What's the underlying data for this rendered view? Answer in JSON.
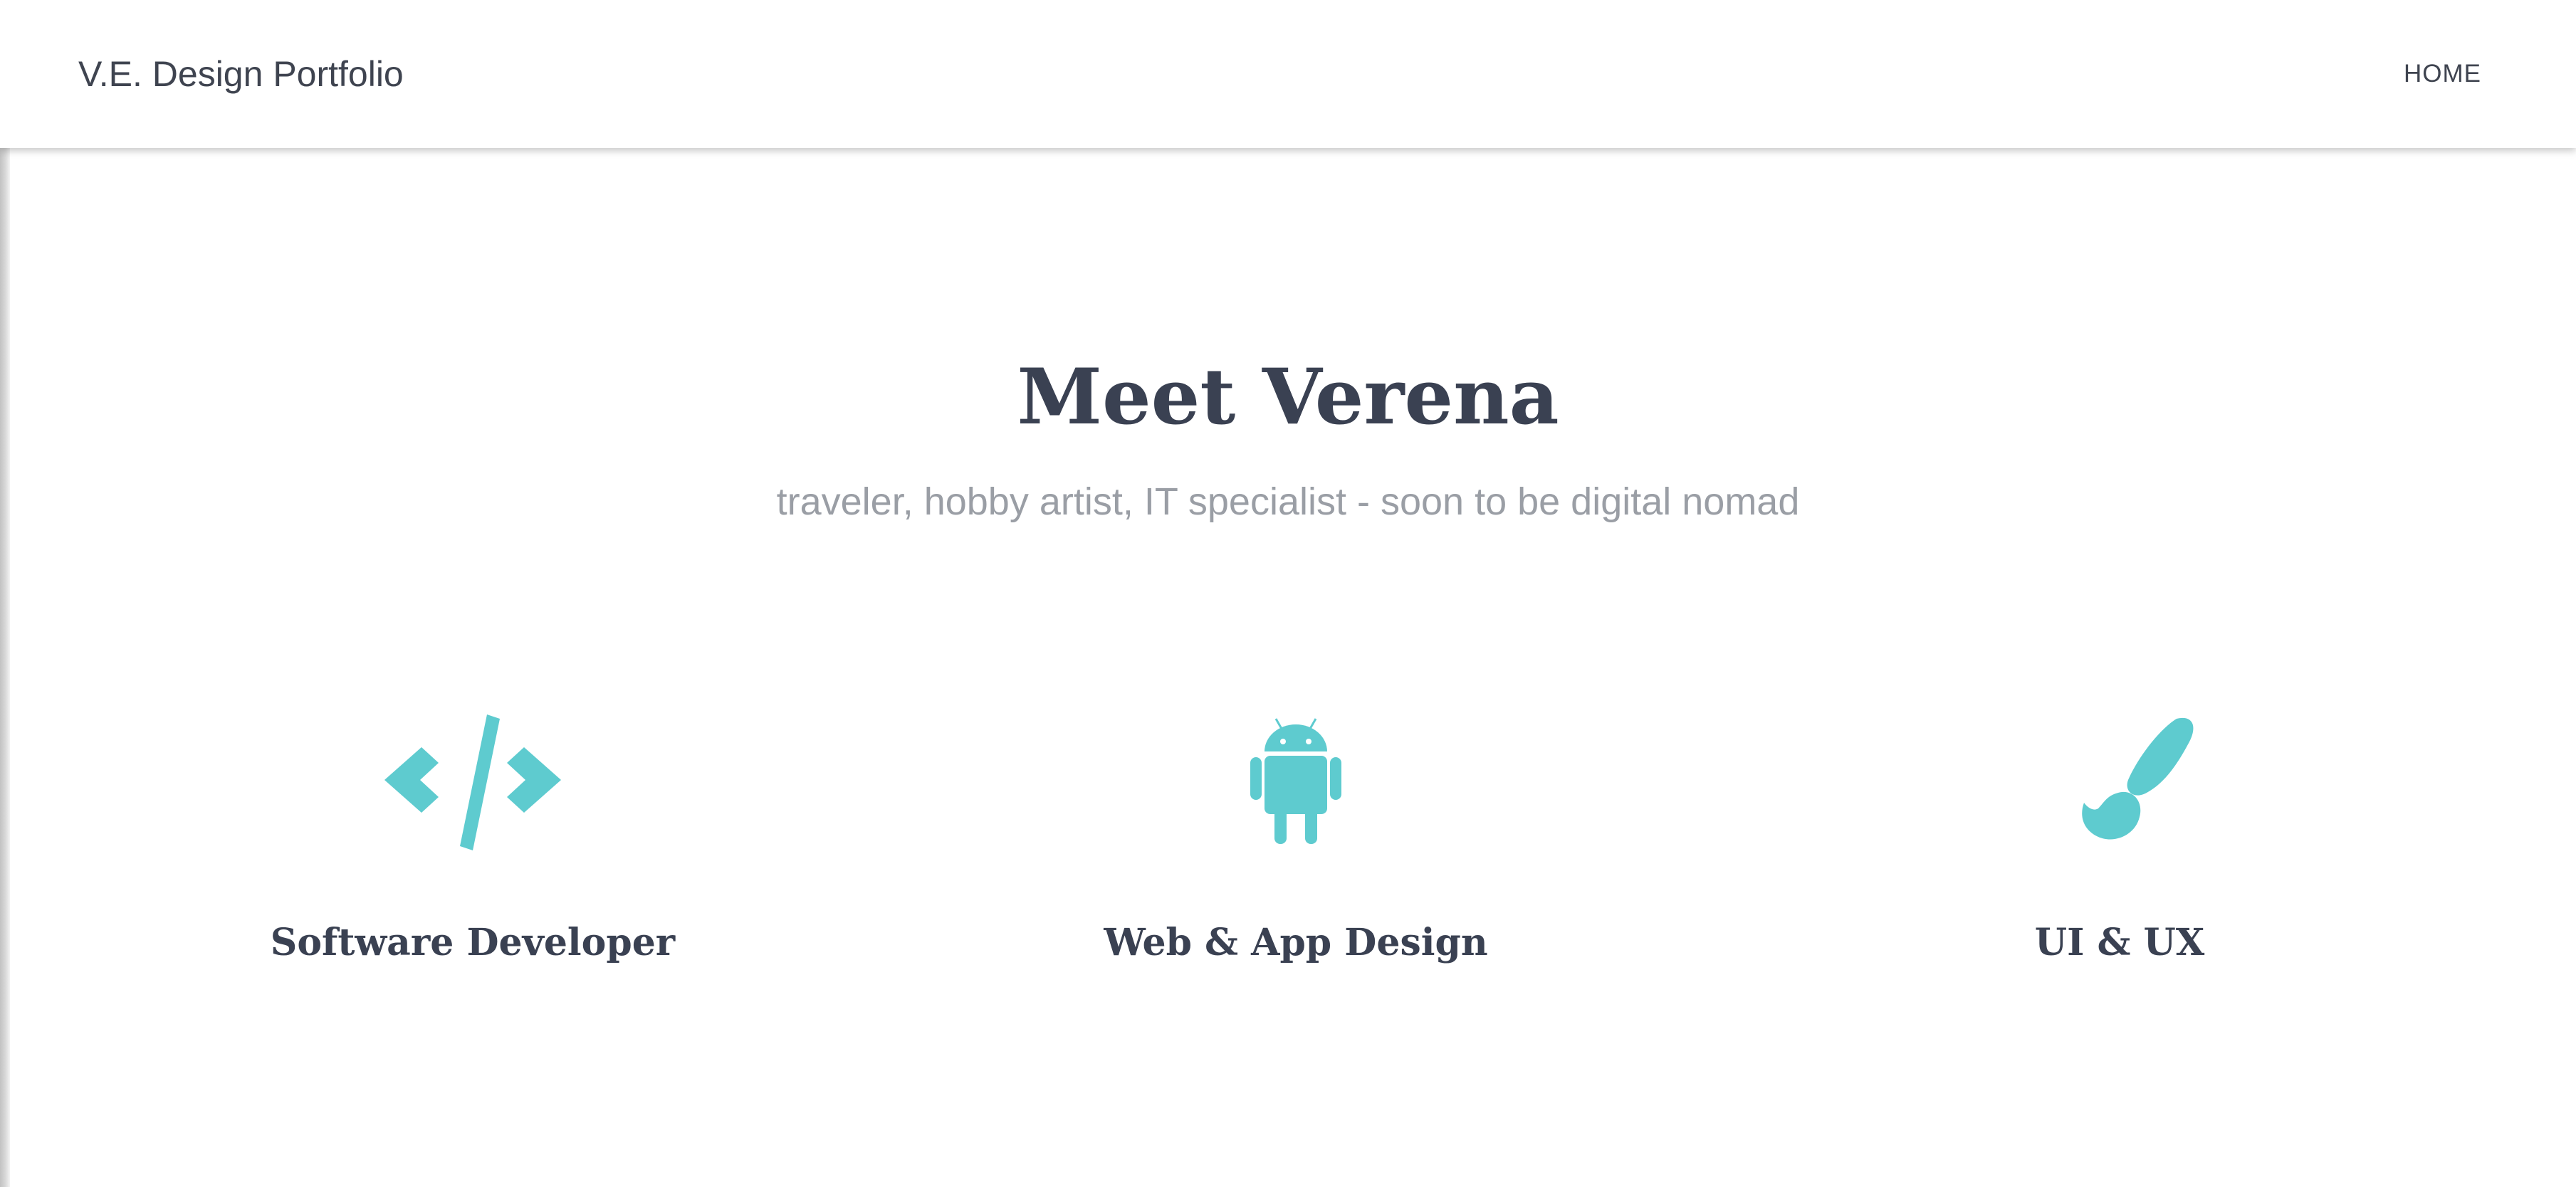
{
  "header": {
    "brand": "V.E. Design Portfolio",
    "nav": [
      {
        "label": "HOME"
      }
    ]
  },
  "hero": {
    "title": "Meet Verena",
    "subtitle": "traveler, hobby artist, IT specialist - soon to be digital nomad"
  },
  "features": [
    {
      "icon": "code-icon",
      "label": "Software Developer"
    },
    {
      "icon": "android-icon",
      "label": "Web & App Design"
    },
    {
      "icon": "paintbrush-icon",
      "label": "UI & UX"
    }
  ],
  "colors": {
    "accent": "#5ecbcf",
    "heading": "#3a4152",
    "subtitle": "#9a9ea5",
    "nav_text": "#3f4450",
    "background": "#ffffff"
  }
}
